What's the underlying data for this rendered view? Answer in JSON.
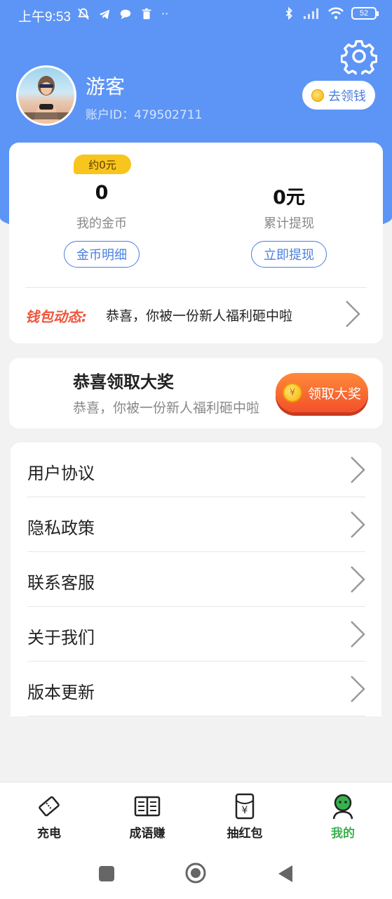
{
  "status_bar": {
    "time": "上午9:53",
    "battery": "52"
  },
  "header": {
    "username": "游客",
    "account_id": "账户ID：479502711",
    "collect_button": "去领钱"
  },
  "wallet": {
    "approx_badge": "约0元",
    "coins_value": "0",
    "coins_label": "我的金币",
    "coins_detail_button": "金币明细",
    "withdrawn_value": "0元",
    "withdrawn_label": "累计提现",
    "withdraw_button": "立即提现",
    "news_label": "钱包动态:",
    "news_text": "恭喜，你被一份新人福利砸中啦"
  },
  "prize": {
    "title": "恭喜领取大奖",
    "subtitle": "恭喜，你被一份新人福利砸中啦",
    "button": "领取大奖"
  },
  "menu": [
    {
      "label": "用户协议"
    },
    {
      "label": "隐私政策"
    },
    {
      "label": "联系客服"
    },
    {
      "label": "关于我们"
    },
    {
      "label": "版本更新"
    }
  ],
  "bottom_nav": [
    {
      "label": "充电",
      "icon": "ticket-icon"
    },
    {
      "label": "成语赚",
      "icon": "book-icon"
    },
    {
      "label": "抽红包",
      "icon": "red-envelope-icon"
    },
    {
      "label": "我的",
      "icon": "profile-icon",
      "active": true
    }
  ],
  "colors": {
    "primary": "#5d95f6",
    "accent_red": "#f0543a",
    "active_green": "#37b24d",
    "badge_yellow": "#f8c51e"
  }
}
